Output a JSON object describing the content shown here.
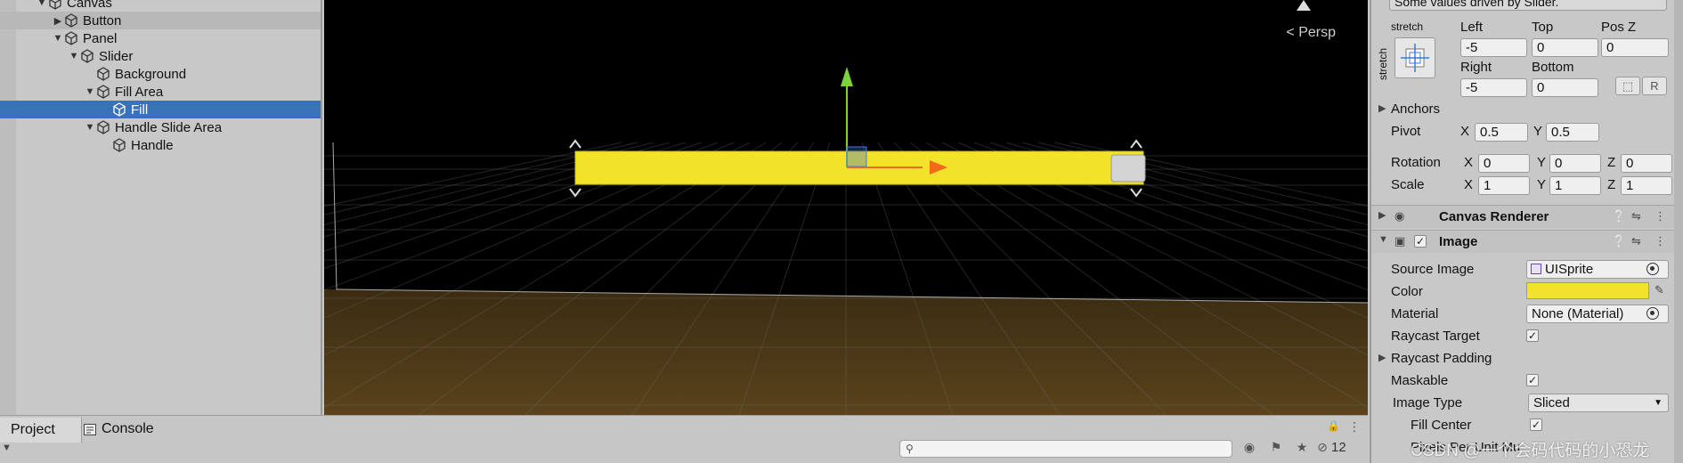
{
  "hierarchy": {
    "items": [
      {
        "label": "Canvas",
        "depth": 2,
        "expanded": true
      },
      {
        "label": "Button",
        "depth": 3,
        "expanded": false
      },
      {
        "label": "Panel",
        "depth": 3,
        "expanded": true
      },
      {
        "label": "Slider",
        "depth": 4,
        "expanded": true
      },
      {
        "label": "Background",
        "depth": 5
      },
      {
        "label": "Fill Area",
        "depth": 5,
        "expanded": true
      },
      {
        "label": "Fill",
        "depth": 6,
        "selected": true
      },
      {
        "label": "Handle Slide Area",
        "depth": 5,
        "expanded": true
      },
      {
        "label": "Handle",
        "depth": 6
      }
    ]
  },
  "scene": {
    "camera_label": "Persp",
    "slider_fill_color": "#f2e32a",
    "ground_color": "#4a3718"
  },
  "bottom_bar": {
    "tabs": [
      {
        "label": "Project"
      },
      {
        "label": "Console"
      }
    ],
    "hidden_count": "12"
  },
  "inspector": {
    "driven_note": "Some values driven by Slider.",
    "anchor_preset": {
      "h": "stretch",
      "v": "stretch"
    },
    "rect": {
      "left_label": "Left",
      "left": "-5",
      "top_label": "Top",
      "top": "0",
      "posz_label": "Pos Z",
      "posz": "0",
      "right_label": "Right",
      "right": "-5",
      "bottom_label": "Bottom",
      "bottom": "0",
      "r_button": "R"
    },
    "anchors_label": "Anchors",
    "pivot": {
      "label": "Pivot",
      "x": "0.5",
      "y": "0.5"
    },
    "rotation": {
      "label": "Rotation",
      "x": "0",
      "y": "0",
      "z": "0"
    },
    "scale": {
      "label": "Scale",
      "x": "1",
      "y": "1",
      "z": "1"
    },
    "axes": {
      "x": "X",
      "y": "Y",
      "z": "Z"
    },
    "canvas_renderer": {
      "title": "Canvas Renderer"
    },
    "image": {
      "title": "Image",
      "source_image_label": "Source Image",
      "source_image": "UISprite",
      "color_label": "Color",
      "color_value": "#f2e32a",
      "material_label": "Material",
      "material": "None (Material)",
      "raycast_target_label": "Raycast Target",
      "raycast_padding_label": "Raycast Padding",
      "maskable_label": "Maskable",
      "image_type_label": "Image Type",
      "image_type": "Sliced",
      "fill_center_label": "Fill Center",
      "pixels_per_unit_label": "Pixels Per Unit Mu"
    },
    "watermark": "CSDN @一个会码代码的小恐龙"
  }
}
